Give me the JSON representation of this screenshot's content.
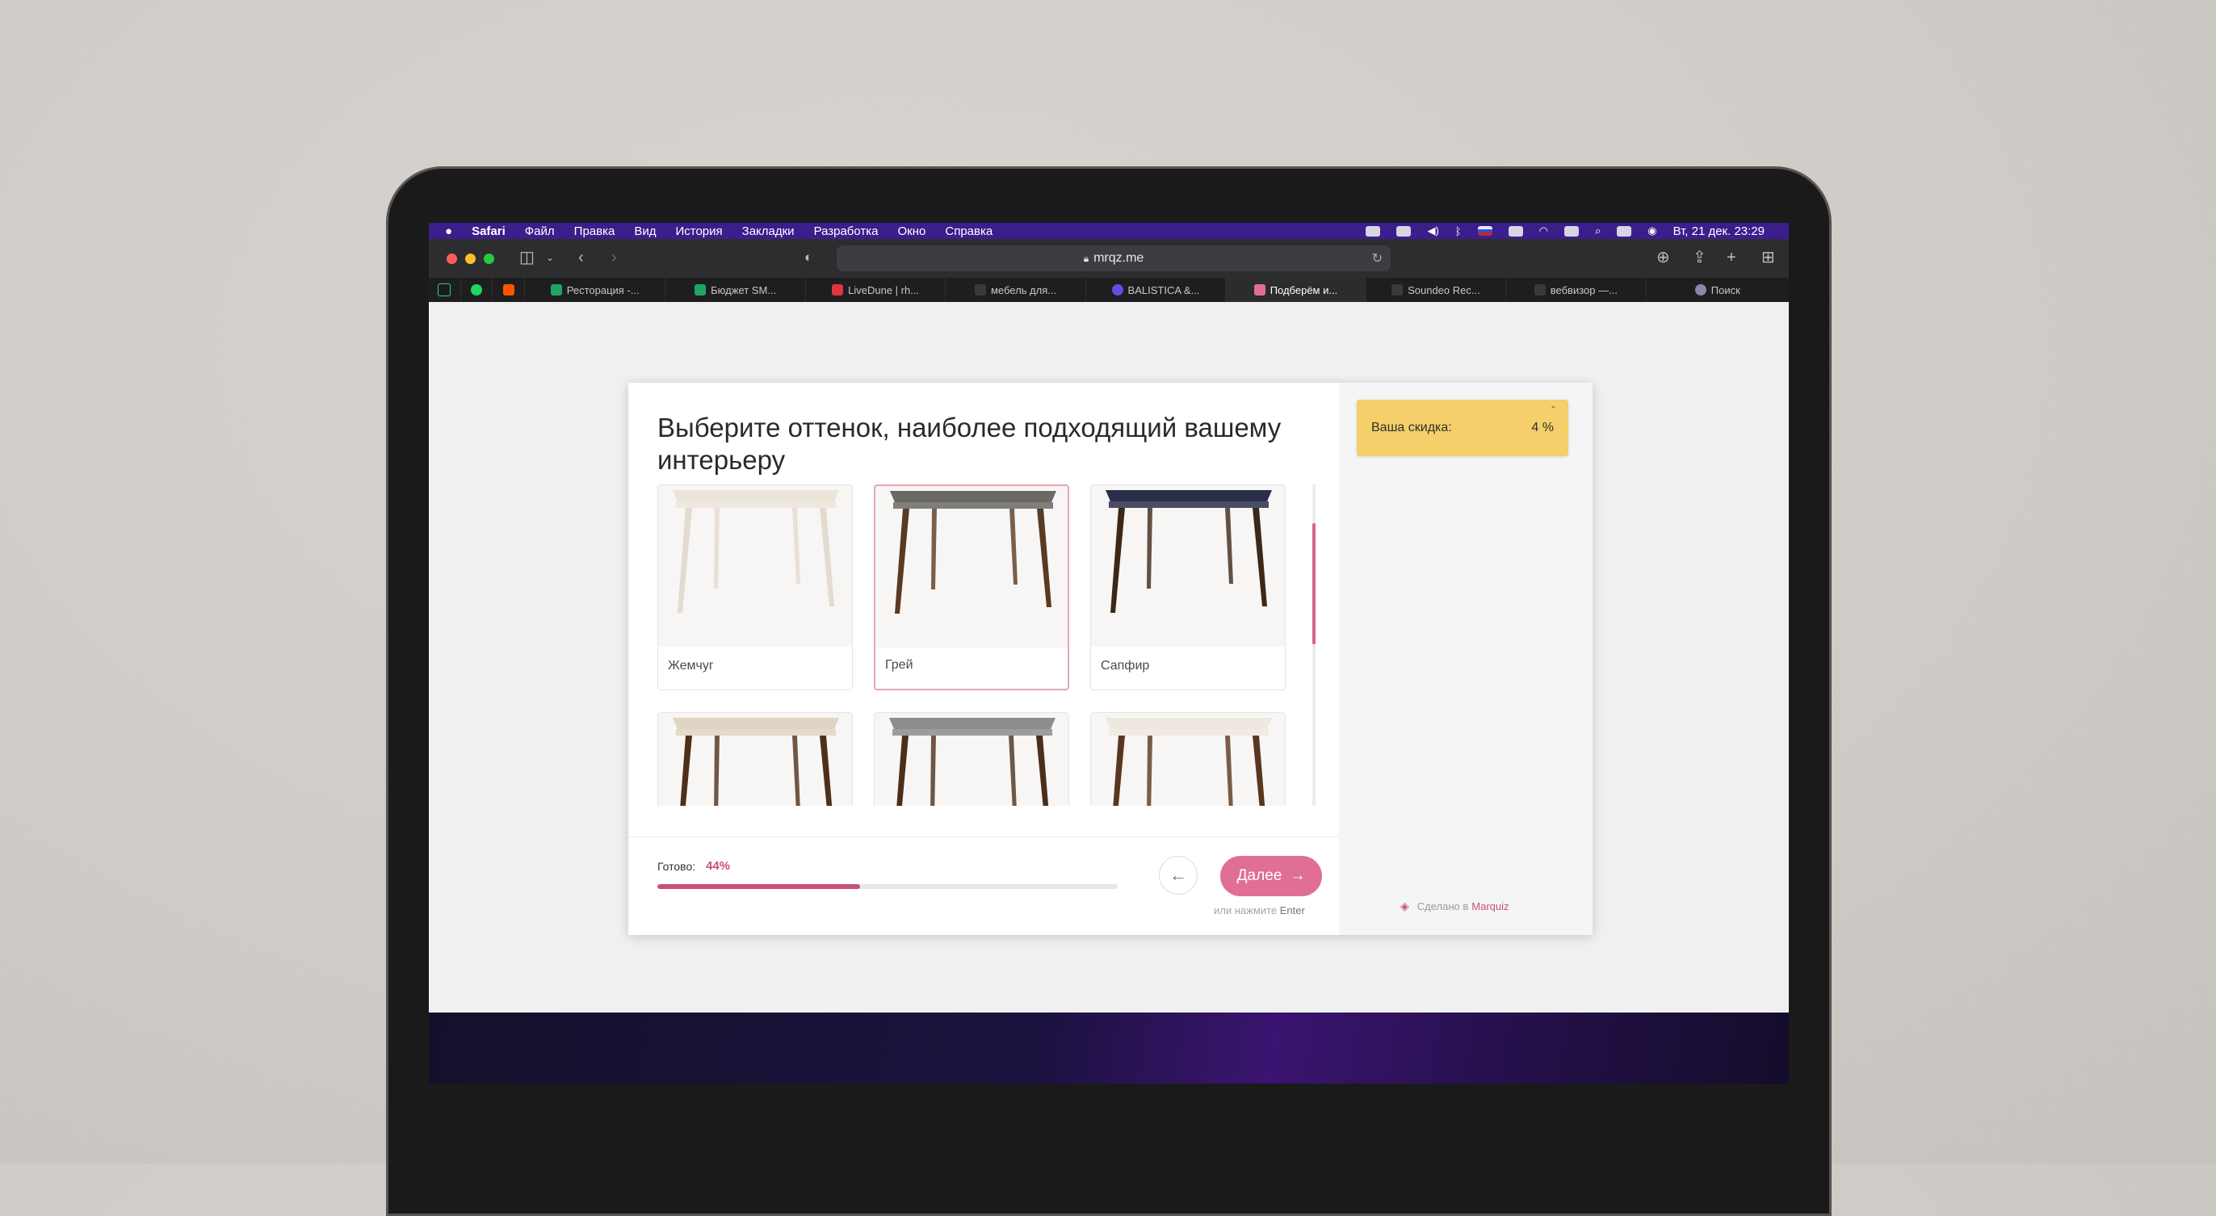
{
  "menubar": {
    "items": [
      "Safari",
      "Файл",
      "Правка",
      "Вид",
      "История",
      "Закладки",
      "Разработка",
      "Окно",
      "Справка"
    ],
    "clock": "Вт, 21 дек. 23:29"
  },
  "browser": {
    "url": "mrqz.me",
    "tabs": [
      {
        "label": "Ресторация -...",
        "icon": "sheets-icon",
        "color": "#1fa463"
      },
      {
        "label": "Бюджет SM...",
        "icon": "sheets-icon",
        "color": "#1fa463"
      },
      {
        "label": "LiveDune | rh...",
        "icon": "livedune-icon",
        "color": "#e2343b"
      },
      {
        "label": "мебель для...",
        "icon": "page-icon",
        "color": "#3a3a3d"
      },
      {
        "label": "BALISTICA &...",
        "icon": "balistica-icon",
        "color": "#6a4be0"
      },
      {
        "label": "Подберём и...",
        "icon": "marquiz-icon",
        "color": "#e06e95",
        "active": true
      },
      {
        "label": "Soundeo Rec...",
        "icon": "page-icon",
        "color": "#3a3a3d"
      },
      {
        "label": "вебвизор —...",
        "icon": "metrika-icon",
        "color": "#3a3a3d"
      },
      {
        "label": "Поиск",
        "icon": "globe-icon",
        "color": "#8888aa"
      }
    ]
  },
  "quiz": {
    "question": "Выберите оттенок, наиболее подходящий вашему интерьеру",
    "options": [
      {
        "label": "Жемчуг",
        "top": "#ece5da",
        "leg": "#e3dbcf",
        "selected": false
      },
      {
        "label": "Грей",
        "top": "#6b6964",
        "leg": "#5a3a22",
        "selected": true
      },
      {
        "label": "Сапфир",
        "top": "#2c2f4a",
        "leg": "#3d2818",
        "selected": false
      },
      {
        "label": "",
        "top": "#e0d4c3",
        "leg": "#4e301a",
        "selected": false
      },
      {
        "label": "",
        "top": "#8d8d8f",
        "leg": "#4a2f1c",
        "selected": false
      },
      {
        "label": "",
        "top": "#efe8de",
        "leg": "#5a3620",
        "selected": false
      }
    ],
    "progress_label": "Готово:",
    "progress_value": "44%",
    "progress_fraction": 0.44,
    "back_arrow": "←",
    "next_label": "Далее",
    "next_arrow": "→",
    "hint_prefix": "или нажмите",
    "hint_key": "Enter"
  },
  "sidebar": {
    "discount_label": "Ваша скидка:",
    "discount_value": "4 %",
    "made_by_prefix": "Сделано в",
    "made_by_brand": "Marquiz"
  },
  "colors": {
    "accent": "#e06e95",
    "progress": "#c7507d",
    "discount_bg": "#f4cf6a",
    "menubar": "#3a1e8c"
  }
}
